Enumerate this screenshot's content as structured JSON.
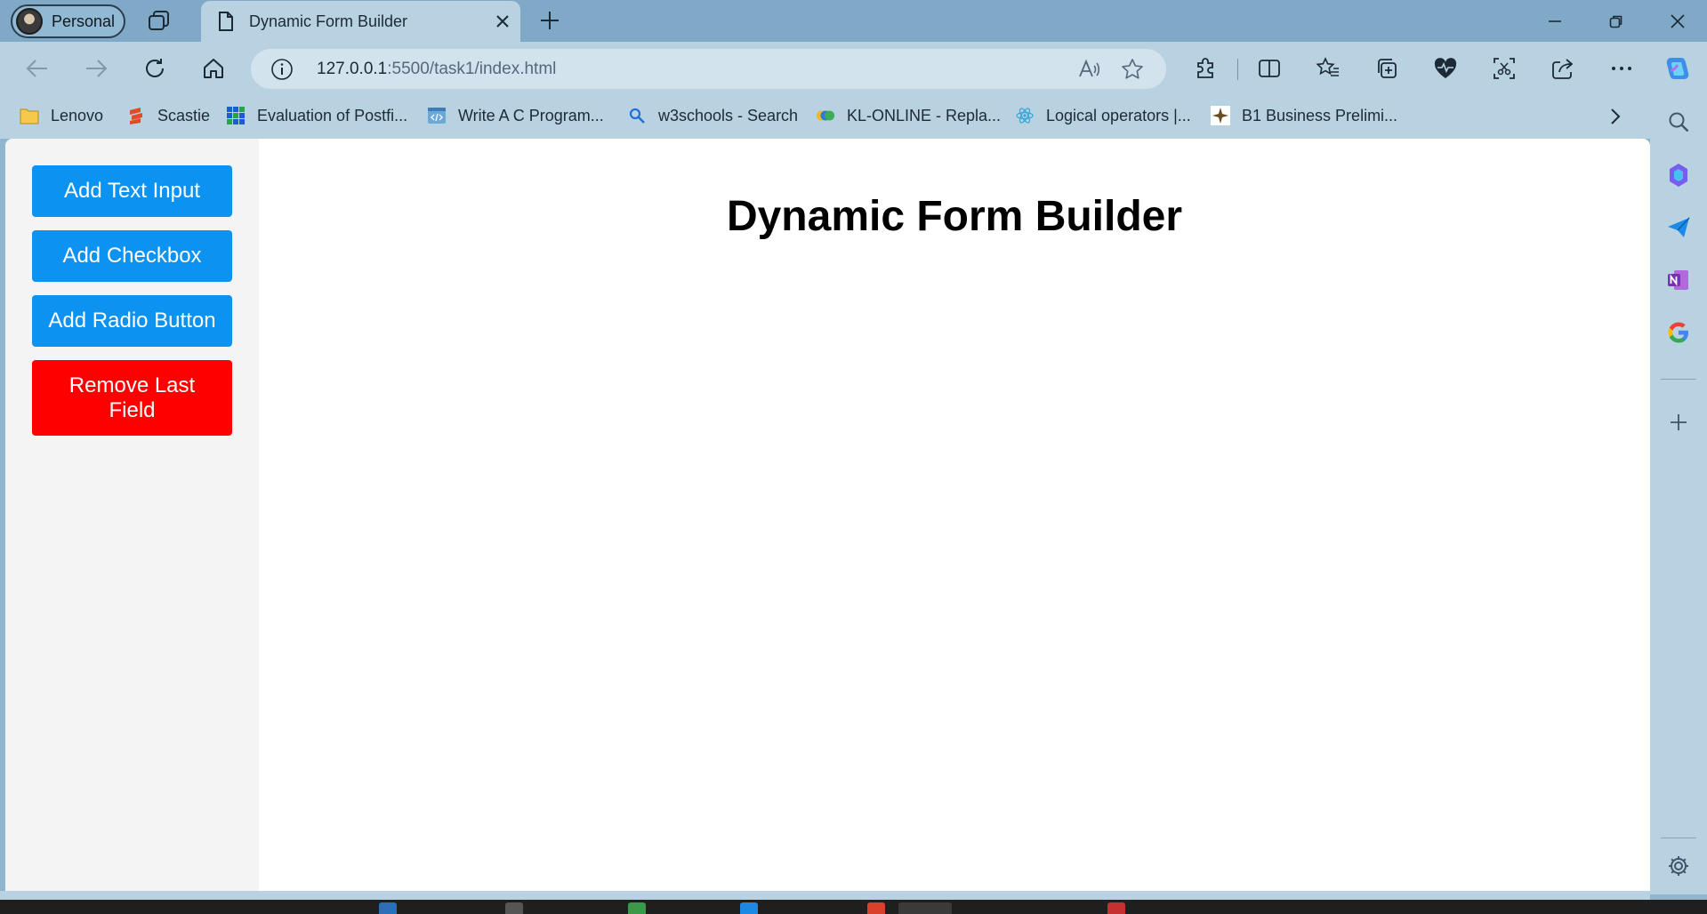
{
  "window": {
    "profile_label": "Personal",
    "tab_title": "Dynamic Form Builder"
  },
  "toolbar": {
    "url_host": "127.0.0.1",
    "url_rest": ":5500/task1/index.html"
  },
  "bookmarks": [
    {
      "label": "Lenovo",
      "icon": "folder-icon"
    },
    {
      "label": "Scastie",
      "icon": "scastie-icon"
    },
    {
      "label": "Evaluation of Postfi...",
      "icon": "grid-icon"
    },
    {
      "label": "Write A C Program...",
      "icon": "code-icon"
    },
    {
      "label": "w3schools - Search",
      "icon": "search-icon"
    },
    {
      "label": "KL-ONLINE - Repla...",
      "icon": "kl-online-icon"
    },
    {
      "label": "Logical operators |...",
      "icon": "react-icon"
    },
    {
      "label": "B1 Business Prelimi...",
      "icon": "compass-icon"
    }
  ],
  "app": {
    "title": "Dynamic Form Builder",
    "buttons": {
      "add_text": "Add Text Input",
      "add_checkbox": "Add Checkbox",
      "add_radio": "Add Radio Button",
      "remove_last": "Remove Last Field"
    },
    "colors": {
      "primary_button": "#0c93f2",
      "danger_button": "#ff0000",
      "sidebar_bg": "#f4f4f4"
    }
  }
}
